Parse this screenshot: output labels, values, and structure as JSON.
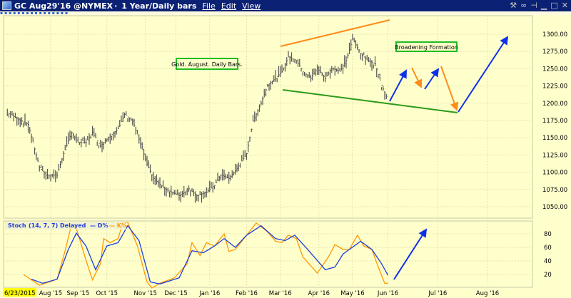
{
  "window": {
    "title": "GC Aug29'16 @NYMEX",
    "period": "1 Year/Daily bars",
    "menu": [
      "File",
      "Edit",
      "View"
    ],
    "controls": [
      "wrench-icon",
      "link-icon",
      "pin-icon",
      "minimize-icon",
      "maximize-icon",
      "close-icon"
    ]
  },
  "start_date": "6/23/2015",
  "colors": {
    "background": "#ffffcc",
    "titlebar": "#0b2173",
    "bars": "#555555",
    "d_line": "#1f3ddb",
    "k_line": "#ff9900",
    "support": "#2a9a1a",
    "resistance": "#ff8c1a",
    "arrow_up": "#1030e8",
    "arrow_down": "#ff8c1a"
  },
  "annotations": {
    "label_left": "Gold. August. Daily Bars.",
    "label_right": "Broadening Formation"
  },
  "chart_data": [
    {
      "type": "bar",
      "title": "GC Aug29'16 @NYMEX 1 Year/Daily bars",
      "x_unit": "trading day index since 6/23/2015",
      "ylim": [
        1030,
        1320
      ],
      "xlim": [
        0,
        327
      ],
      "y_ticks": [
        1050,
        1075,
        1100,
        1125,
        1150,
        1175,
        1200,
        1225,
        1250,
        1275,
        1300
      ],
      "x_ticks": [
        {
          "label": "Aug '15",
          "x": 28
        },
        {
          "label": "Sep '15",
          "x": 45
        },
        {
          "label": "Oct '15",
          "x": 63
        },
        {
          "label": "Nov '15",
          "x": 87
        },
        {
          "label": "Dec '15",
          "x": 106
        },
        {
          "label": "Jan '16",
          "x": 127
        },
        {
          "label": "Feb '16",
          "x": 150
        },
        {
          "label": "Mar '16",
          "x": 171
        },
        {
          "label": "Apr '16",
          "x": 195
        },
        {
          "label": "May '16",
          "x": 216
        },
        {
          "label": "Jun '16",
          "x": 238
        },
        {
          "label": "Jul '16",
          "x": 269
        },
        {
          "label": "Aug '16",
          "x": 300
        }
      ],
      "close_points": {
        "x": [
          1,
          14,
          21,
          25,
          32,
          36,
          41,
          45,
          50,
          54,
          59,
          63,
          70,
          74,
          79,
          83,
          88,
          92,
          99,
          108,
          114,
          119,
          125,
          130,
          134,
          139,
          143,
          150,
          154,
          159,
          163,
          168,
          172,
          176,
          181,
          185,
          190,
          194,
          199,
          203,
          208,
          212,
          216,
          221,
          225,
          230,
          234,
          237
        ],
        "y": [
          1186,
          1169,
          1107,
          1096,
          1096,
          1127,
          1158,
          1143,
          1143,
          1158,
          1138,
          1148,
          1163,
          1184,
          1174,
          1148,
          1112,
          1091,
          1076,
          1066,
          1076,
          1066,
          1071,
          1081,
          1096,
          1091,
          1102,
          1127,
          1174,
          1200,
          1226,
          1236,
          1246,
          1267,
          1262,
          1246,
          1236,
          1251,
          1236,
          1251,
          1246,
          1262,
          1293,
          1272,
          1262,
          1257,
          1226,
          1210
        ]
      }
    },
    {
      "type": "line",
      "title": "Stoch",
      "params": "(14, 7, 7) Delayed",
      "ylim": [
        0,
        100
      ],
      "y_ticks": [
        20,
        40,
        60,
        80
      ],
      "series": [
        {
          "name": "D%",
          "x": [
            16,
            23,
            32,
            39,
            44,
            50,
            56,
            63,
            70,
            76,
            83,
            90,
            96,
            108,
            116,
            123,
            130,
            136,
            143,
            150,
            159,
            168,
            174,
            180,
            188,
            199,
            205,
            210,
            214,
            221,
            228,
            234,
            238
          ],
          "values": [
            13,
            7,
            13,
            57,
            81,
            62,
            27,
            62,
            67,
            92,
            70,
            9,
            6,
            15,
            55,
            52,
            62,
            73,
            60,
            78,
            92,
            73,
            70,
            78,
            57,
            27,
            31,
            50,
            57,
            69,
            57,
            36,
            19
          ]
        },
        {
          "name": "K%",
          "x": [
            11,
            21,
            32,
            37,
            41,
            44,
            50,
            54,
            59,
            61,
            65,
            70,
            73,
            76,
            82,
            88,
            91,
            96,
            105,
            113,
            116,
            121,
            125,
            130,
            136,
            139,
            143,
            150,
            156,
            163,
            168,
            172,
            176,
            181,
            185,
            194,
            201,
            205,
            210,
            214,
            219,
            223,
            228,
            232,
            236,
            238
          ],
          "values": [
            20,
            4,
            13,
            55,
            94,
            88,
            41,
            12,
            36,
            73,
            67,
            73,
            97,
            97,
            62,
            9,
            0,
            7,
            15,
            36,
            67,
            48,
            67,
            62,
            80,
            54,
            57,
            78,
            96,
            83,
            69,
            67,
            78,
            73,
            46,
            22,
            46,
            64,
            57,
            57,
            78,
            62,
            57,
            31,
            7,
            7
          ]
        }
      ]
    }
  ]
}
